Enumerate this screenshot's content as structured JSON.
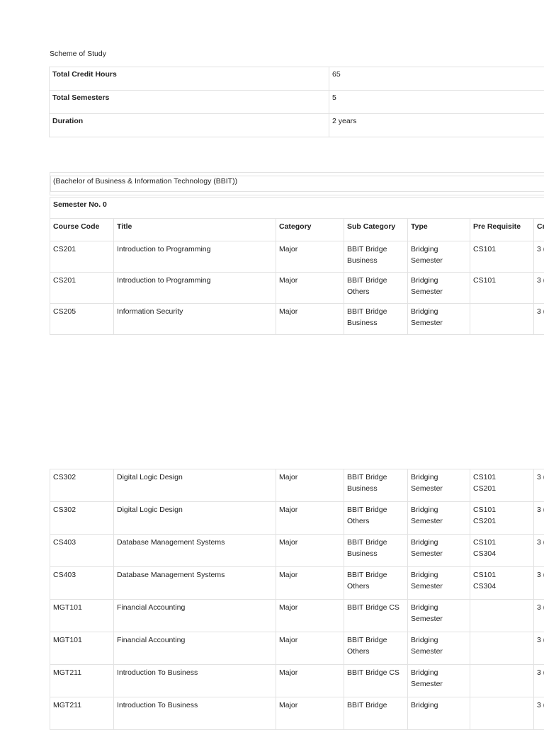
{
  "heading": "Scheme of Study",
  "summary": [
    {
      "label": "Total Credit Hours",
      "value": "65"
    },
    {
      "label": "Total Semesters",
      "value": "5"
    },
    {
      "label": "Duration",
      "value": "2 years"
    }
  ],
  "program": "(Bachelor of Business & Information Technology (BBIT))",
  "semester": "Semester No. 0",
  "columns": [
    "Course Code",
    "Title",
    "Category",
    "Sub Category",
    "Type",
    "Pre Requisite",
    "Cr"
  ],
  "rows_top": [
    {
      "code": "CS201",
      "title": "Introduction to Programming",
      "category": "Major",
      "sub": "BBIT Bridge Business",
      "type": "Bridging Semester",
      "pre": "CS101",
      "credit": "3 ("
    },
    {
      "code": "CS201",
      "title": "Introduction to Programming",
      "category": "Major",
      "sub": "BBIT Bridge Others",
      "type": "Bridging Semester",
      "pre": "CS101",
      "credit": "3 ("
    },
    {
      "code": "CS205",
      "title": "Information Security",
      "category": "Major",
      "sub": "BBIT Bridge Business",
      "type": "Bridging Semester",
      "pre": "",
      "credit": "3 ("
    }
  ],
  "rows_bottom": [
    {
      "code": "CS302",
      "title": "Digital Logic Design",
      "category": "Major",
      "sub": "BBIT Bridge Business",
      "type": "Bridging Semester",
      "pre": "CS101 CS201",
      "credit": "3 ("
    },
    {
      "code": "CS302",
      "title": "Digital Logic Design",
      "category": "Major",
      "sub": "BBIT Bridge Others",
      "type": "Bridging Semester",
      "pre": "CS101 CS201",
      "credit": "3 ("
    },
    {
      "code": "CS403",
      "title": "Database Management Systems",
      "category": "Major",
      "sub": "BBIT Bridge Business",
      "type": "Bridging Semester",
      "pre": "CS101 CS304",
      "credit": "3 ("
    },
    {
      "code": "CS403",
      "title": "Database Management Systems",
      "category": "Major",
      "sub": "BBIT Bridge Others",
      "type": "Bridging Semester",
      "pre": "CS101 CS304",
      "credit": "3 ("
    },
    {
      "code": "MGT101",
      "title": "Financial Accounting",
      "category": "Major",
      "sub": "BBIT Bridge CS",
      "type": "Bridging Semester",
      "pre": "",
      "credit": "3 ("
    },
    {
      "code": "MGT101",
      "title": "Financial Accounting",
      "category": "Major",
      "sub": "BBIT Bridge Others",
      "type": "Bridging Semester",
      "pre": "",
      "credit": "3 ("
    },
    {
      "code": "MGT211",
      "title": "Introduction To Business",
      "category": "Major",
      "sub": "BBIT Bridge CS",
      "type": "Bridging Semester",
      "pre": "",
      "credit": "3 ("
    },
    {
      "code": "MGT211",
      "title": "Introduction To Business",
      "category": "Major",
      "sub": "BBIT Bridge",
      "type": "Bridging",
      "pre": "",
      "credit": "3 ("
    }
  ]
}
